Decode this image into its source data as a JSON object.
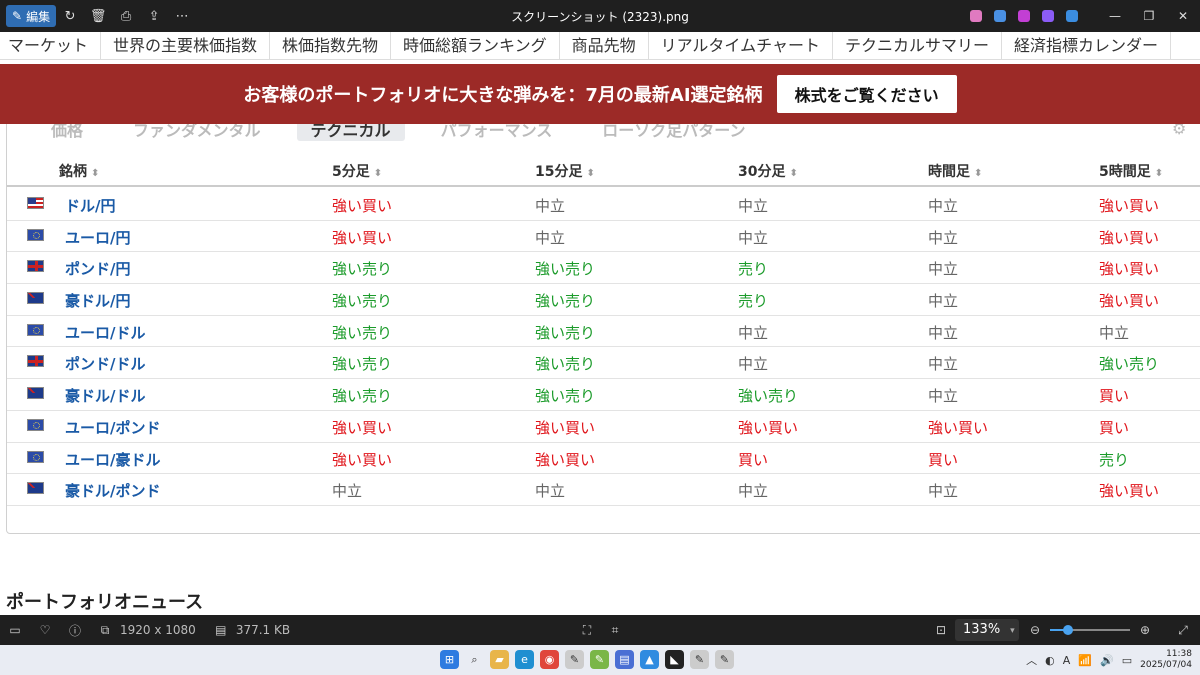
{
  "titlebar": {
    "edit_label": "編集",
    "title": "スクリーンショット (2323).png"
  },
  "nav": {
    "items": [
      "マーケット",
      "世界の主要株価指数",
      "株価指数先物",
      "時価総額ランキング",
      "商品先物",
      "リアルタイムチャート",
      "テクニカルサマリー",
      "経済指標カレンダー"
    ]
  },
  "banner": {
    "text": "お客様のポートフォリオに大きな弾みを：7月の最新AI選定銘柄",
    "button": "株式をご覧ください"
  },
  "tabs": [
    "価格",
    "ファンダメンタル",
    "テクニカル",
    "パフォーマンス",
    "ローソク足パターン"
  ],
  "active_tab": "テクニカル",
  "table": {
    "headers": [
      "銘柄",
      "5分足",
      "15分足",
      "30分足",
      "時間足",
      "5時間足"
    ],
    "rows": [
      {
        "flag": "us",
        "pair": "ドル/円",
        "c1": "強い買い",
        "c2": "中立",
        "c3": "中立",
        "c4": "中立",
        "c5": "強い買い"
      },
      {
        "flag": "eu",
        "pair": "ユーロ/円",
        "c1": "強い買い",
        "c2": "中立",
        "c3": "中立",
        "c4": "中立",
        "c5": "強い買い"
      },
      {
        "flag": "uk",
        "pair": "ポンド/円",
        "c1": "強い売り",
        "c2": "強い売り",
        "c3": "売り",
        "c4": "中立",
        "c5": "強い買い"
      },
      {
        "flag": "au",
        "pair": "豪ドル/円",
        "c1": "強い売り",
        "c2": "強い売り",
        "c3": "売り",
        "c4": "中立",
        "c5": "強い買い"
      },
      {
        "flag": "eu",
        "pair": "ユーロ/ドル",
        "c1": "強い売り",
        "c2": "強い売り",
        "c3": "中立",
        "c4": "中立",
        "c5": "中立"
      },
      {
        "flag": "uk",
        "pair": "ポンド/ドル",
        "c1": "強い売り",
        "c2": "強い売り",
        "c3": "中立",
        "c4": "中立",
        "c5": "強い売り"
      },
      {
        "flag": "au",
        "pair": "豪ドル/ドル",
        "c1": "強い売り",
        "c2": "強い売り",
        "c3": "強い売り",
        "c4": "中立",
        "c5": "買い"
      },
      {
        "flag": "eu",
        "pair": "ユーロ/ポンド",
        "c1": "強い買い",
        "c2": "強い買い",
        "c3": "強い買い",
        "c4": "強い買い",
        "c5": "買い"
      },
      {
        "flag": "eu",
        "pair": "ユーロ/豪ドル",
        "c1": "強い買い",
        "c2": "強い買い",
        "c3": "買い",
        "c4": "買い",
        "c5": "売り"
      },
      {
        "flag": "au",
        "pair": "豪ドル/ポンド",
        "c1": "中立",
        "c2": "中立",
        "c3": "中立",
        "c4": "中立",
        "c5": "強い買い"
      }
    ]
  },
  "news_title": "ポートフォリオニュース",
  "statusbar": {
    "dimensions": "1920 x 1080",
    "filesize": "377.1 KB",
    "zoom": "133%",
    "zoom_level": 0.22
  },
  "clock": {
    "time": "11:38",
    "date": "2025/07/04"
  },
  "colors": {
    "buy": "#e0161c",
    "sell": "#1b9b2a",
    "neutral": "#666666",
    "banner": "#9c2a27",
    "link": "#1a5aa6"
  }
}
